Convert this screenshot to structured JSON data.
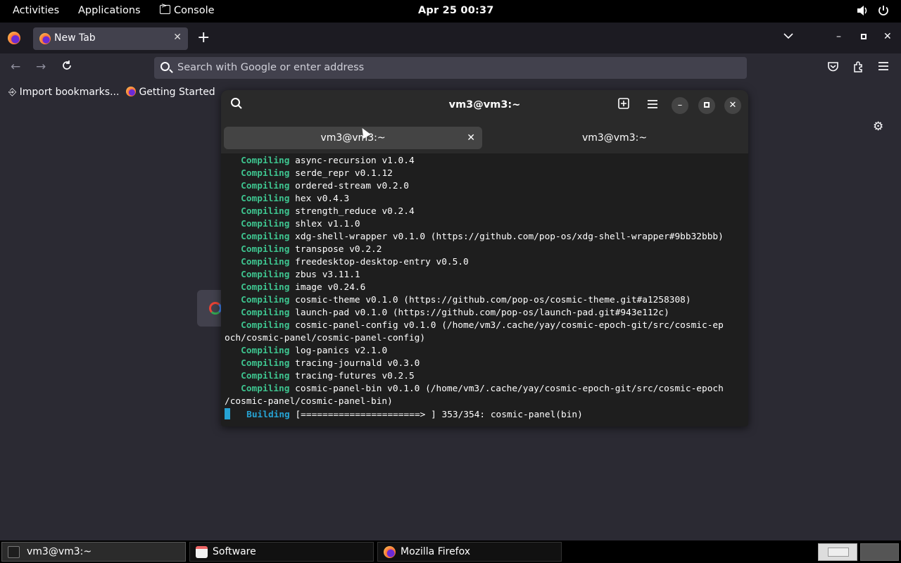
{
  "topbar": {
    "activities": "Activities",
    "applications": "Applications",
    "console": "Console",
    "clock": "Apr 25  00:37"
  },
  "firefox": {
    "tab_title": "New Tab",
    "url_placeholder": "Search with Google or enter address",
    "bookmarks": [
      "Import bookmarks...",
      "Getting Started"
    ]
  },
  "terminal": {
    "title": "vm3@vm3:~",
    "tabs": [
      "vm3@vm3:~",
      "vm3@vm3:~"
    ],
    "lines": [
      {
        "kw": "Compiling",
        "rest": " async-recursion v1.0.4"
      },
      {
        "kw": "Compiling",
        "rest": " serde_repr v0.1.12"
      },
      {
        "kw": "Compiling",
        "rest": " ordered-stream v0.2.0"
      },
      {
        "kw": "Compiling",
        "rest": " hex v0.4.3"
      },
      {
        "kw": "Compiling",
        "rest": " strength_reduce v0.2.4"
      },
      {
        "kw": "Compiling",
        "rest": " shlex v1.1.0"
      },
      {
        "kw": "Compiling",
        "rest": " xdg-shell-wrapper v0.1.0 (https://github.com/pop-os/xdg-shell-wrapper#9bb32bbb)"
      },
      {
        "kw": "Compiling",
        "rest": " transpose v0.2.2"
      },
      {
        "kw": "Compiling",
        "rest": " freedesktop-desktop-entry v0.5.0"
      },
      {
        "kw": "Compiling",
        "rest": " zbus v3.11.1"
      },
      {
        "kw": "Compiling",
        "rest": " image v0.24.6"
      },
      {
        "kw": "Compiling",
        "rest": " cosmic-theme v0.1.0 (https://github.com/pop-os/cosmic-theme.git#a1258308)"
      },
      {
        "kw": "Compiling",
        "rest": " launch-pad v0.1.0 (https://github.com/pop-os/launch-pad.git#943e112c)"
      },
      {
        "kw": "Compiling",
        "rest": " cosmic-panel-config v0.1.0 (/home/vm3/.cache/yay/cosmic-epoch-git/src/cosmic-ep",
        "cont": "och/cosmic-panel/cosmic-panel-config)"
      },
      {
        "kw": "Compiling",
        "rest": " log-panics v2.1.0"
      },
      {
        "kw": "Compiling",
        "rest": " tracing-journald v0.3.0"
      },
      {
        "kw": "Compiling",
        "rest": " tracing-futures v0.2.5"
      },
      {
        "kw": "Compiling",
        "rest": " cosmic-panel-bin v0.1.0 (/home/vm3/.cache/yay/cosmic-epoch-git/src/cosmic-epoch",
        "cont": "/cosmic-panel/cosmic-panel-bin)"
      }
    ],
    "building_kw": "Building",
    "building_rest": " [======================> ] 353/354: cosmic-panel(bin)"
  },
  "taskbar": {
    "items": [
      "vm3@vm3:~",
      "Software",
      "Mozilla Firefox"
    ]
  },
  "colors": {
    "compiling": "#3ec48f",
    "building": "#26a3d4"
  }
}
